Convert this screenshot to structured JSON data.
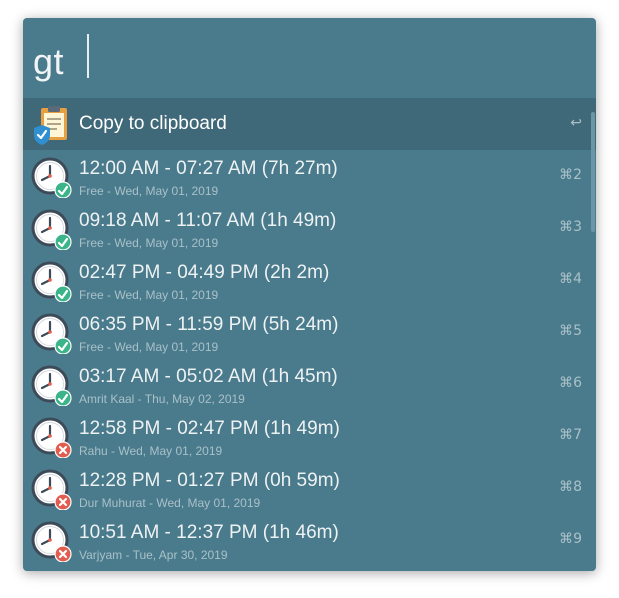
{
  "query": {
    "value": "gt"
  },
  "top_result": {
    "title": "Copy to clipboard",
    "shortcut": "↩"
  },
  "results": [
    {
      "title": "12:00 AM - 07:27 AM (7h 27m)",
      "subtitle": "Free - Wed, May 01, 2019",
      "shortcut": "⌘2",
      "status": "ok"
    },
    {
      "title": "09:18 AM - 11:07 AM (1h 49m)",
      "subtitle": "Free - Wed, May 01, 2019",
      "shortcut": "⌘3",
      "status": "ok"
    },
    {
      "title": "02:47 PM - 04:49 PM (2h 2m)",
      "subtitle": "Free - Wed, May 01, 2019",
      "shortcut": "⌘4",
      "status": "ok"
    },
    {
      "title": "06:35 PM - 11:59 PM (5h 24m)",
      "subtitle": "Free - Wed, May 01, 2019",
      "shortcut": "⌘5",
      "status": "ok"
    },
    {
      "title": "03:17 AM - 05:02 AM (1h 45m)",
      "subtitle": "Amrit Kaal - Thu, May 02, 2019",
      "shortcut": "⌘6",
      "status": "ok"
    },
    {
      "title": "12:58 PM - 02:47 PM (1h 49m)",
      "subtitle": "Rahu - Wed, May 01, 2019",
      "shortcut": "⌘7",
      "status": "bad"
    },
    {
      "title": "12:28 PM - 01:27 PM (0h 59m)",
      "subtitle": "Dur Muhurat - Wed, May 01, 2019",
      "shortcut": "⌘8",
      "status": "bad"
    },
    {
      "title": "10:51 AM - 12:37 PM (1h 46m)",
      "subtitle": "Varjyam - Tue, Apr 30, 2019",
      "shortcut": "⌘9",
      "status": "bad"
    }
  ],
  "colors": {
    "background": "#4a7b8c",
    "selected": "#3f6878",
    "ok_badge": "#3cb48a",
    "bad_badge": "#e25d4f"
  }
}
